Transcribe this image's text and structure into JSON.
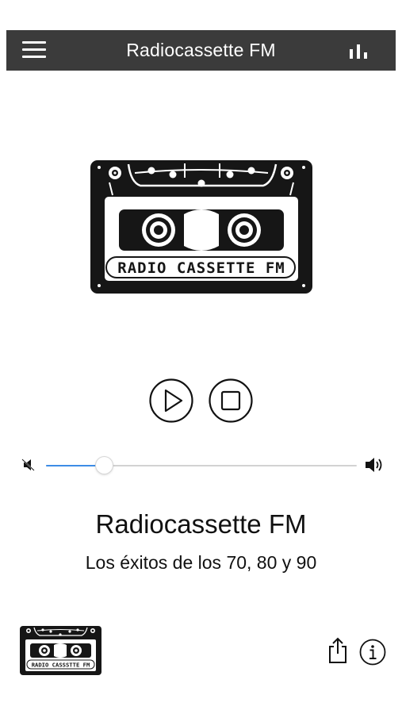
{
  "navbar": {
    "title": "Radiocassette FM",
    "menu_icon": "hamburger-menu-icon",
    "right_icon": "equalizer-bars-icon"
  },
  "logo": {
    "text": "RADIO CASSETTE FM",
    "small_text": "RADIO CASSSTTE FM"
  },
  "controls": {
    "play_icon": "play-icon",
    "stop_icon": "stop-icon"
  },
  "volume": {
    "level": 0.19,
    "min_icon": "volume-mute-icon",
    "max_icon": "volume-up-icon"
  },
  "station": {
    "name": "Radiocassette FM",
    "tagline": "Los éxitos de los 70, 80 y 90"
  },
  "footer": {
    "share_icon": "share-icon",
    "info_icon": "info-icon"
  },
  "colors": {
    "navbar_bg": "#3b3b3b",
    "slider_fill": "#3d8ce6",
    "slider_track": "#d2d2d2"
  }
}
